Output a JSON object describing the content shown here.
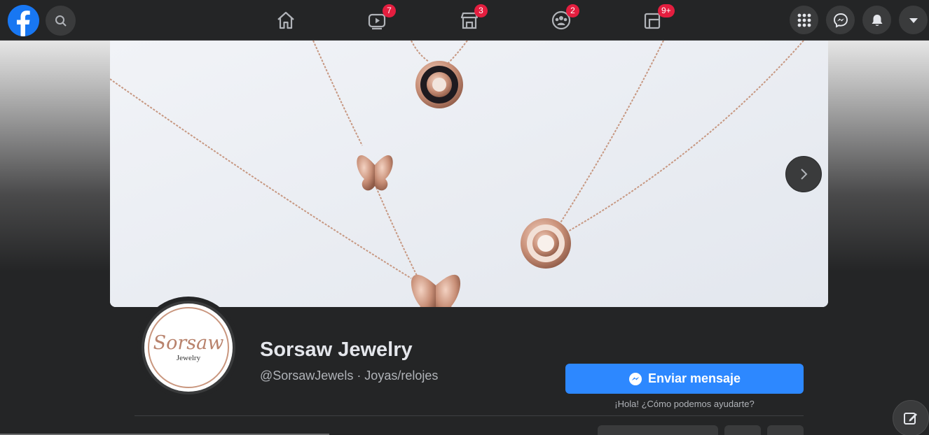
{
  "topbar": {
    "nav": [
      {
        "name": "home",
        "icon": "home-icon",
        "badge": ""
      },
      {
        "name": "watch",
        "icon": "video-icon",
        "badge": "7"
      },
      {
        "name": "marketplace",
        "icon": "store-icon",
        "badge": "3"
      },
      {
        "name": "groups",
        "icon": "groups-icon",
        "badge": "2"
      },
      {
        "name": "gaming",
        "icon": "gaming-icon",
        "badge": "9+"
      }
    ],
    "right_icons": [
      "menu-grid-icon",
      "messenger-icon",
      "notifications-icon",
      "account-dropdown-icon"
    ]
  },
  "cover": {
    "photo": "rose-gold necklaces on white background"
  },
  "profile": {
    "avatar_script_text": "Sorsaw",
    "avatar_small_text": "Jewelry",
    "name": "Sorsaw Jewelry",
    "subtitle": "@SorsawJewels · Joyas/relojes"
  },
  "actions": {
    "send_message_label": "Enviar mensaje",
    "greeting": "¡Hola! ¿Cómo podemos ayudarte?"
  },
  "colors": {
    "brand_blue": "#1877f2",
    "button_blue": "#2d88ff",
    "badge_red": "#e41e3f",
    "surface": "#242526",
    "surface_alt": "#3a3b3c"
  }
}
